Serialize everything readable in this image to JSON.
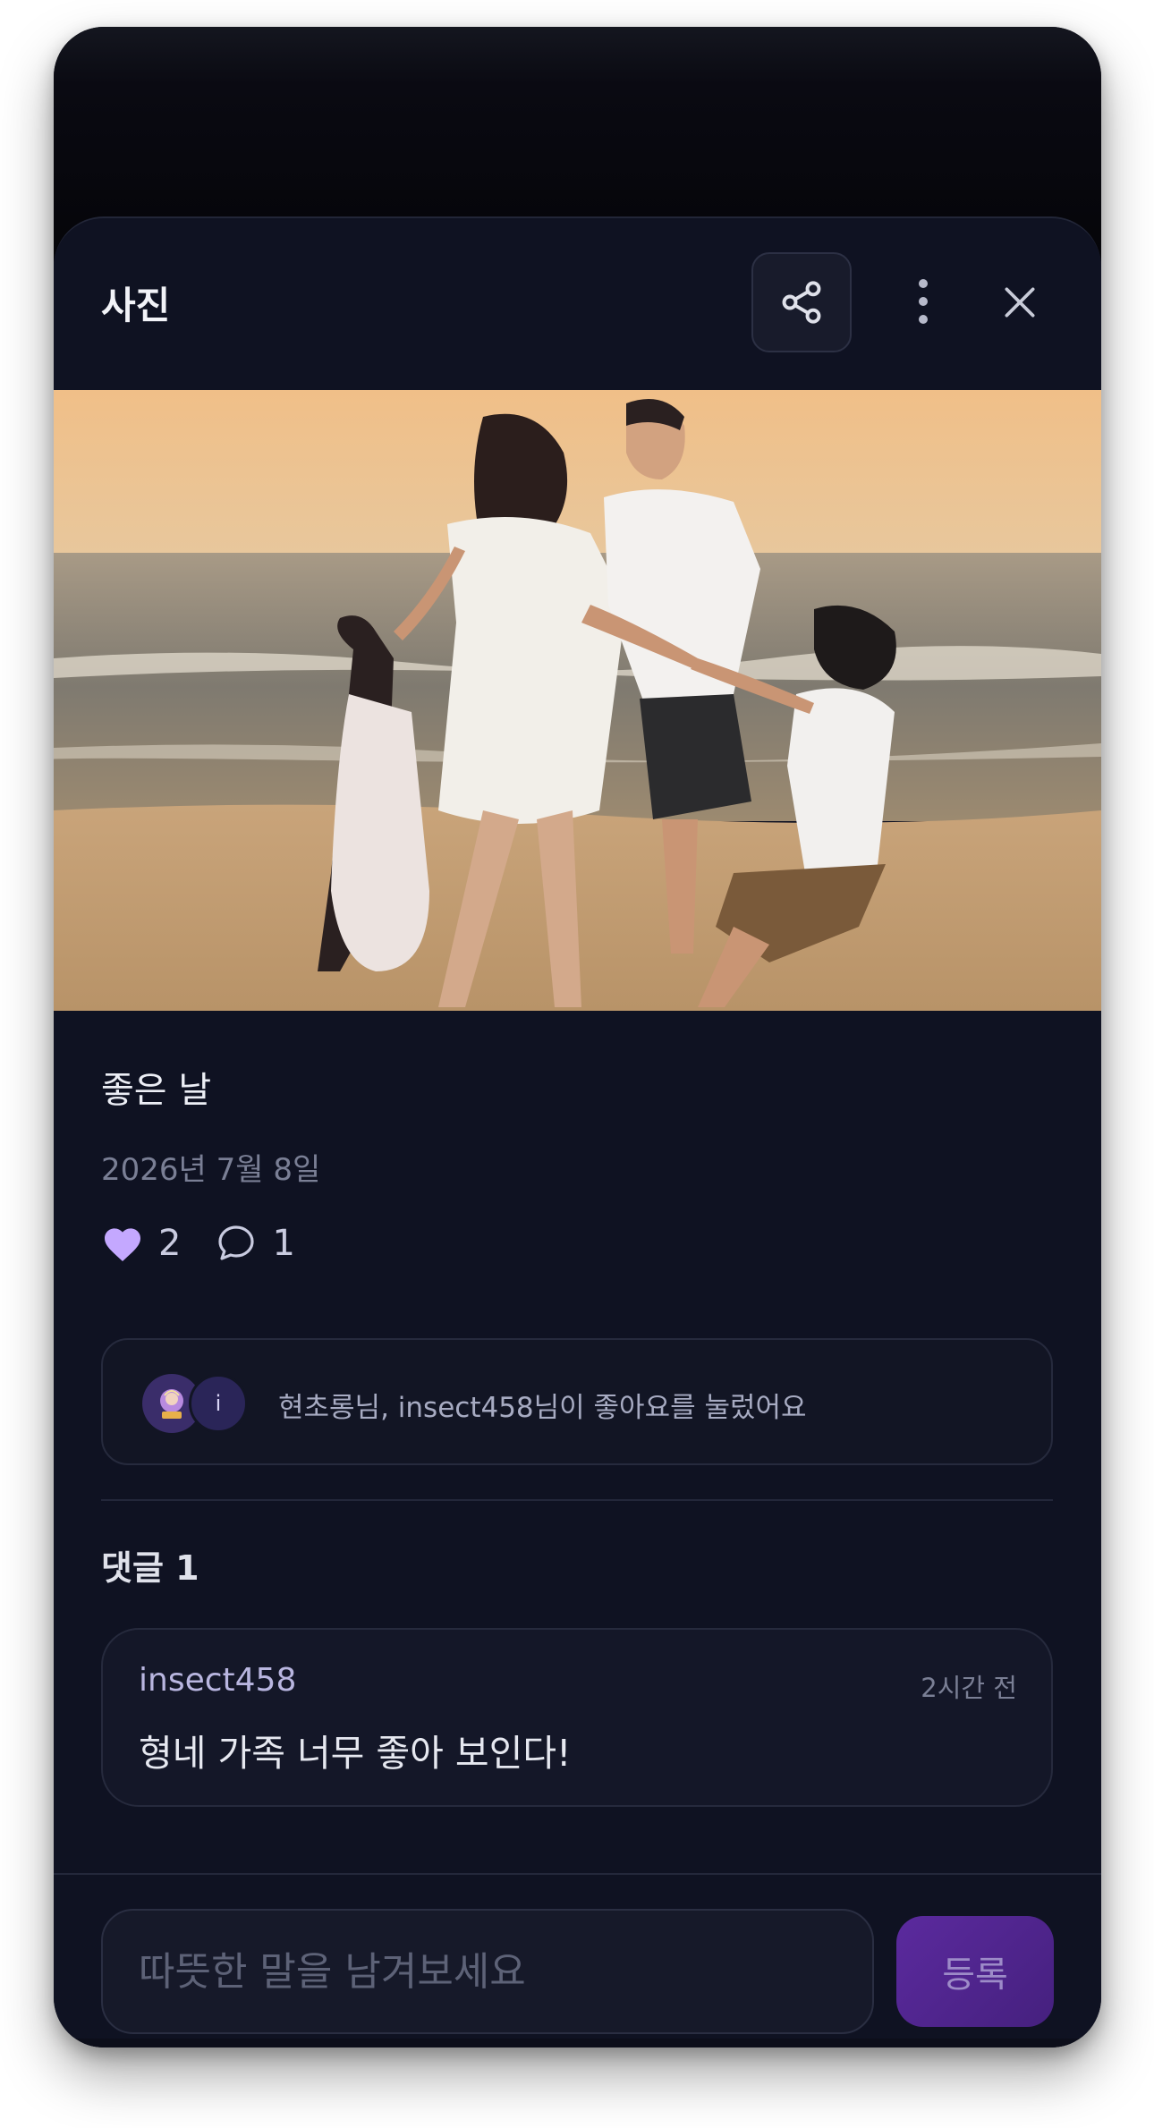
{
  "header": {
    "title": "사진",
    "share_icon": "share-icon",
    "more_icon": "more-vertical-icon",
    "close_icon": "close-icon"
  },
  "post": {
    "caption": "좋은 날",
    "date": "2026년 7월 8일",
    "like_count": "2",
    "comment_count": "1",
    "liked": true
  },
  "likes_summary": {
    "avatars": [
      "",
      "i"
    ],
    "text": "현초롱님, insect458님이 좋아요를 눌렀어요"
  },
  "comments": {
    "heading": "댓글 1",
    "items": [
      {
        "user": "insect458",
        "time": "2시간 전",
        "body": "형네 가족 너무 좋아 보인다!"
      }
    ]
  },
  "composer": {
    "placeholder": "따뜻한 말을 남겨보세요",
    "submit_label": "등록"
  },
  "colors": {
    "background": "#0f1222",
    "accent": "#c4a8ff",
    "submit": "#5b2a9e"
  }
}
